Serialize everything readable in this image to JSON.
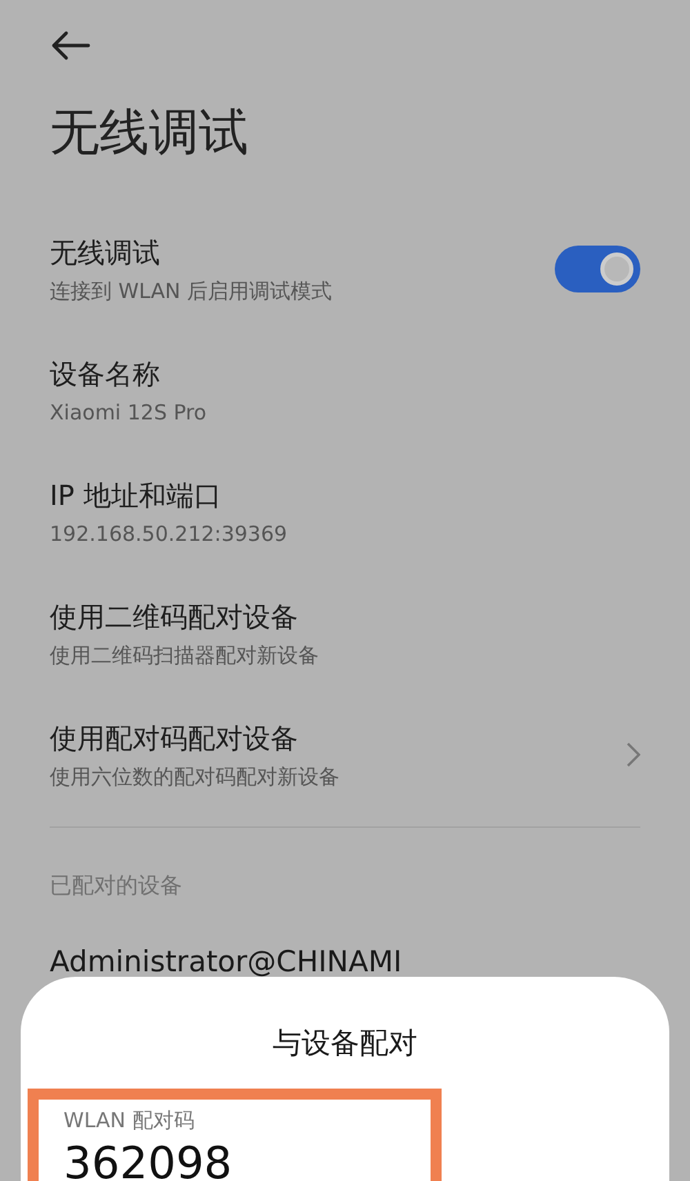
{
  "header": {
    "title": "无线调试"
  },
  "settings": [
    {
      "kind": "toggle",
      "title": "无线调试",
      "subtitle": "连接到 WLAN 后启用调试模式",
      "on": true
    },
    {
      "kind": "info",
      "title": "设备名称",
      "subtitle": "Xiaomi 12S Pro"
    },
    {
      "kind": "info",
      "title": "IP 地址和端口",
      "subtitle": "192.168.50.212:39369"
    },
    {
      "kind": "info",
      "title": "使用二维码配对设备",
      "subtitle": "使用二维码扫描器配对新设备"
    },
    {
      "kind": "link",
      "title": "使用配对码配对设备",
      "subtitle": "使用六位数的配对码配对新设备"
    }
  ],
  "paired_section": {
    "heading": "已配对的设备",
    "devices": [
      "Administrator@CHINAMI"
    ]
  },
  "dialog": {
    "title": "与设备配对",
    "code_label": "WLAN 配对码",
    "code": "362098"
  }
}
